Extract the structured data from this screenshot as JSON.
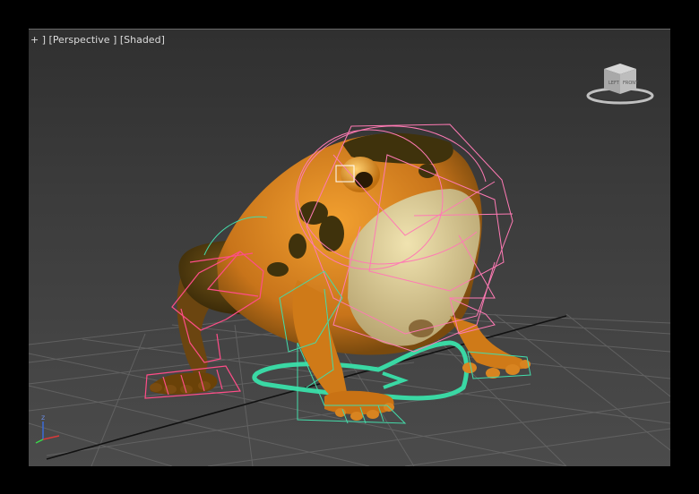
{
  "viewport": {
    "menus": {
      "plus": "+",
      "view": "Perspective",
      "shading": "Shaded"
    }
  },
  "viewcube": {
    "faces": {
      "left": "LEFT",
      "front": "FRONT"
    }
  },
  "axis_gizmo": {
    "z_label": "z"
  },
  "colors": {
    "grid": "#6a6a6a",
    "rig_pink": "#ff6aa8",
    "rig_green": "#40d8a8",
    "frog_orange": "#d9821a",
    "frog_spot": "#4a3a10",
    "frog_belly": "#e4d6a0"
  },
  "icons": [
    "viewcube-icon",
    "axis-gizmo-icon"
  ]
}
